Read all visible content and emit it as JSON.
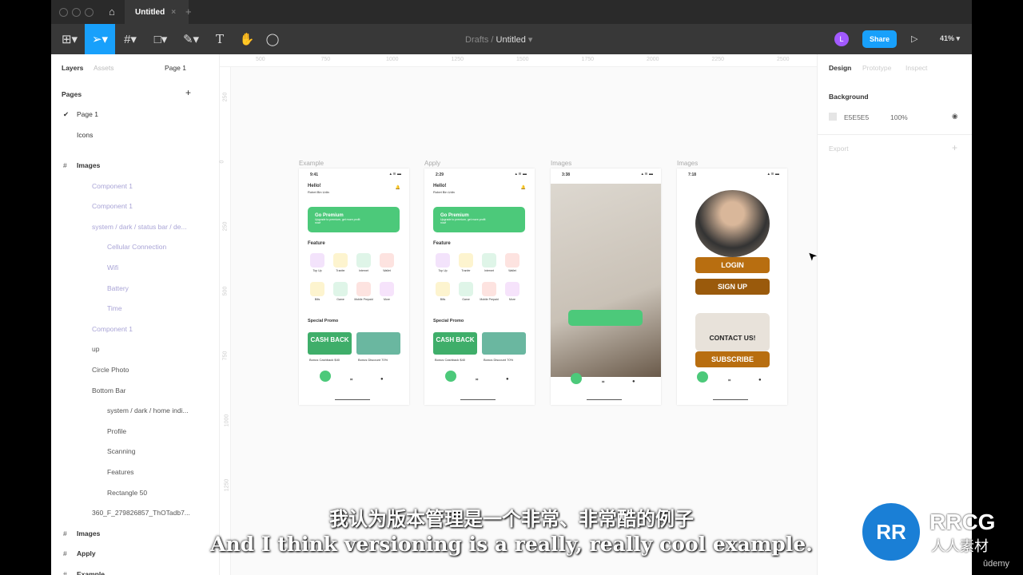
{
  "window": {
    "tab": "Untitled",
    "new_tab": "+",
    "close": "×"
  },
  "toolbar": {
    "breadcrumb_parent": "Drafts",
    "breadcrumb_sep": "/",
    "file_name": "Untitled",
    "avatar": "L",
    "share": "Share",
    "zoom": "41%"
  },
  "left_panel": {
    "tabs": [
      "Layers",
      "Assets"
    ],
    "page_selector": "Page 1",
    "pages_title": "Pages",
    "pages": [
      "Page 1",
      "Icons"
    ],
    "layers": [
      {
        "label": "Images",
        "indent": 0,
        "frame": true
      },
      {
        "label": "Component 1",
        "indent": 1
      },
      {
        "label": "Component 1",
        "indent": 1
      },
      {
        "label": "system / dark / status bar / de...",
        "indent": 1
      },
      {
        "label": "Cellular Connection",
        "indent": 2
      },
      {
        "label": "Wifi",
        "indent": 2
      },
      {
        "label": "Battery",
        "indent": 2
      },
      {
        "label": "Time",
        "indent": 2
      },
      {
        "label": "Component 1",
        "indent": 1
      },
      {
        "label": "up",
        "indent": 1
      },
      {
        "label": "Circle Photo",
        "indent": 1
      },
      {
        "label": "Bottom Bar",
        "indent": 1
      },
      {
        "label": "system / dark / home indi...",
        "indent": 2
      },
      {
        "label": "Profile",
        "indent": 2
      },
      {
        "label": "Scanning",
        "indent": 2
      },
      {
        "label": "Features",
        "indent": 2
      },
      {
        "label": "Rectangle 50",
        "indent": 2
      },
      {
        "label": "360_F_279826857_ThOTadb7...",
        "indent": 1
      },
      {
        "label": "Images",
        "indent": 0,
        "frame": true
      },
      {
        "label": "Apply",
        "indent": 0,
        "frame": true
      },
      {
        "label": "Example",
        "indent": 0,
        "frame": true
      }
    ]
  },
  "ruler": {
    "top": [
      "500",
      "750",
      "1000",
      "1250",
      "1500",
      "1750",
      "2000",
      "2250",
      "2500"
    ],
    "left": [
      "250",
      "0",
      "250",
      "500",
      "750",
      "1000",
      "1250"
    ]
  },
  "right_panel": {
    "tabs": [
      "Design",
      "Prototype",
      "Inspect"
    ],
    "background_title": "Background",
    "bg_hex": "E5E5E5",
    "bg_opacity": "100%",
    "export": "Export"
  },
  "frames": [
    {
      "label": "Example",
      "time": "9:41",
      "hello": "Hello!",
      "name": "Robet Bin Udin",
      "premium": "Go Premium",
      "premium_sub": "Upgrade to premium, get more profit now!",
      "feature": "Feature",
      "icons": [
        "Top Up",
        "Tranfer",
        "Internet",
        "Wallet",
        "Bills",
        "Game",
        "Mobile Prepaid",
        "More"
      ],
      "promo_title": "Special Promo",
      "promos": [
        "Bonus Cashback $40",
        "Bonus Discount 70%"
      ],
      "cashback": "CASH BACK"
    },
    {
      "label": "Apply",
      "time": "2:29",
      "hello": "Hello!",
      "name": "Robet Bin Udin",
      "premium": "Go Premium",
      "premium_sub": "Upgrade to premium, get more profit now!",
      "feature": "Feature",
      "icons": [
        "Top Up",
        "Tranfer",
        "Internet",
        "Wallet",
        "Bills",
        "Game",
        "Mobile Prepaid",
        "More"
      ],
      "promo_title": "Special Promo",
      "promos": [
        "Bonus Cashback $40",
        "Bonus Discount 70%"
      ],
      "cashback": "CASH BACK"
    },
    {
      "label": "Images",
      "time": "3:38"
    },
    {
      "label": "Images",
      "time": "7:18",
      "login": "LOGIN",
      "signup": "SIGN UP",
      "contact": "CONTACT US!",
      "subscribe": "SUBSCRIBE"
    }
  ],
  "colors": {
    "accent": "#18a0fb",
    "green": "#4cc97a",
    "brown": "#b86e10",
    "brown_dark": "#9a5a0c"
  },
  "subtitles": {
    "zh": "我认为版本管理是一个非常、非常酷的例子",
    "en": "And I think versioning is a really, really cool example."
  },
  "watermark": {
    "logo": "RRCG",
    "sub": "人人素材",
    "udemy": "ûdemy"
  }
}
